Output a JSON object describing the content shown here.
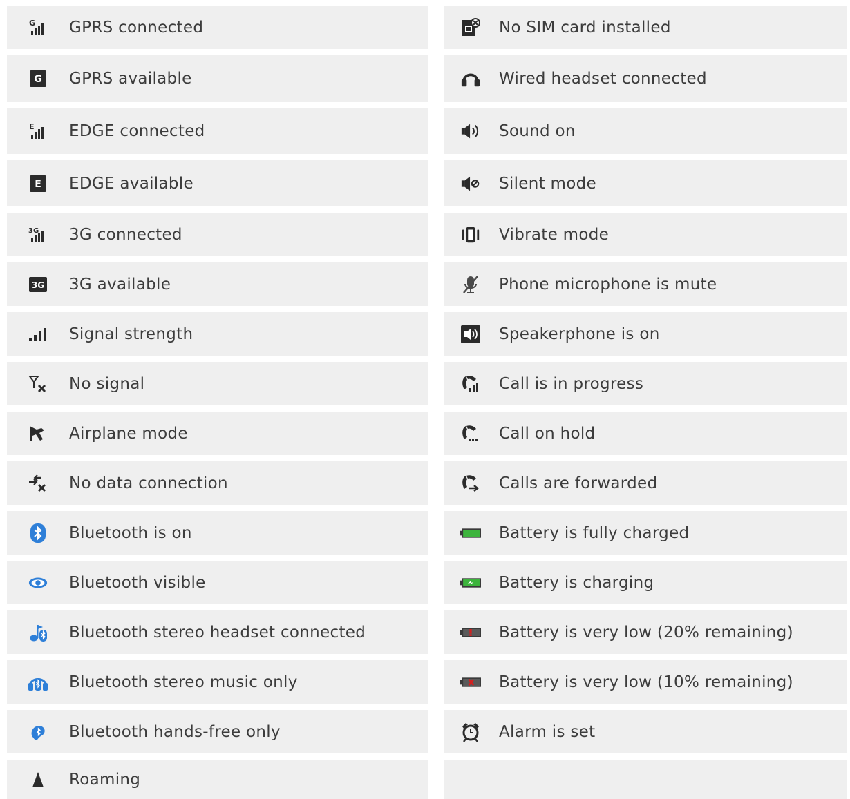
{
  "left_column": [
    {
      "icon": "gprs-connected-icon",
      "label": "GPRS connected"
    },
    {
      "icon": "gprs-available-icon",
      "label": "GPRS available"
    },
    {
      "icon": "edge-connected-icon",
      "label": "EDGE connected"
    },
    {
      "icon": "edge-available-icon",
      "label": "EDGE available"
    },
    {
      "icon": "3g-connected-icon",
      "label": "3G connected"
    },
    {
      "icon": "3g-available-icon",
      "label": "3G available"
    },
    {
      "icon": "signal-strength-icon",
      "label": "Signal strength"
    },
    {
      "icon": "no-signal-icon",
      "label": "No signal"
    },
    {
      "icon": "airplane-mode-icon",
      "label": "Airplane mode"
    },
    {
      "icon": "no-data-connection-icon",
      "label": "No data connection"
    },
    {
      "icon": "bluetooth-on-icon",
      "label": "Bluetooth is on"
    },
    {
      "icon": "bluetooth-visible-icon",
      "label": "Bluetooth visible"
    },
    {
      "icon": "bluetooth-stereo-headset-icon",
      "label": "Bluetooth stereo headset connected"
    },
    {
      "icon": "bluetooth-stereo-music-icon",
      "label": "Bluetooth stereo music only"
    },
    {
      "icon": "bluetooth-hands-free-icon",
      "label": "Bluetooth hands-free only"
    },
    {
      "icon": "roaming-icon",
      "label": "Roaming"
    }
  ],
  "right_column": [
    {
      "icon": "no-sim-card-icon",
      "label": "No SIM card installed"
    },
    {
      "icon": "wired-headset-icon",
      "label": "Wired headset connected"
    },
    {
      "icon": "sound-on-icon",
      "label": "Sound on"
    },
    {
      "icon": "silent-mode-icon",
      "label": "Silent mode"
    },
    {
      "icon": "vibrate-mode-icon",
      "label": "Vibrate mode"
    },
    {
      "icon": "microphone-mute-icon",
      "label": "Phone microphone is mute"
    },
    {
      "icon": "speakerphone-icon",
      "label": "Speakerphone is on"
    },
    {
      "icon": "call-in-progress-icon",
      "label": "Call is in progress"
    },
    {
      "icon": "call-on-hold-icon",
      "label": "Call on hold"
    },
    {
      "icon": "calls-forwarded-icon",
      "label": "Calls are forwarded"
    },
    {
      "icon": "battery-full-icon",
      "label": "Battery is fully charged"
    },
    {
      "icon": "battery-charging-icon",
      "label": "Battery is charging"
    },
    {
      "icon": "battery-low-20-icon",
      "label": "Battery is very low (20% remaining)"
    },
    {
      "icon": "battery-low-10-icon",
      "label": "Battery is very low (10% remaining)"
    },
    {
      "icon": "alarm-icon",
      "label": "Alarm is set"
    },
    {
      "icon": "",
      "label": ""
    }
  ],
  "colors": {
    "row_background": "#efefef",
    "text": "#3c3c3c",
    "icon_dark": "#2b2b2b",
    "bluetooth_blue": "#2e7fd8",
    "battery_green": "#3cb43c",
    "battery_red": "#d42020"
  }
}
